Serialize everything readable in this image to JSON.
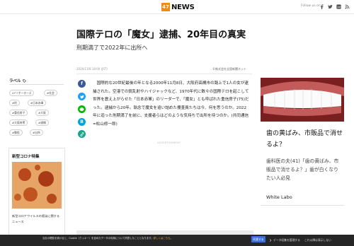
{
  "header": {
    "logo_badge": "47",
    "logo_text": "NEWS",
    "follow_label": "Follow us on",
    "social_icons": [
      "facebook-icon",
      "twitter-icon",
      "line-icon",
      "rss-icon"
    ]
  },
  "article": {
    "title": "国際テロの「魔女」逮捕、20年目の真実",
    "subtitle": "刑期満了で2022年に出所へ",
    "date": "2020/11/8 18:00 (JST)",
    "source": "©株式会社全国新聞ネット",
    "paragraph": "　国際的な20世紀最後の年となる2000年11月8日、大阪府高槻市の路上で1人の女が逮捕された。空港での銃乱射やハイジャックなど、1970年代に数々の国際テロを起こして世界を震え上がらせた「日本赤軍」のリーダーで、「魔女」とも呼ばれた重信房子(75)だった。逮捕から20年。執念で魔女を追い詰めた捜査員たちは今、何を思うのか。2022年に迫った刑期満了を前に、支援者らはどのような気持ちで出所を待つのか。(共同通信=松山修一郎)",
    "ad_label": "ADVERTISEMENT",
    "share_icons": [
      "facebook-icon",
      "twitter-icon",
      "line-icon",
      "hatena-icon",
      "copy-link-icon"
    ]
  },
  "sidebar": {
    "label_heading": "ラベル",
    "tags": [
      "47リポーターズ",
      "#社会",
      "#刑",
      "#日本赤軍",
      "#重信房子",
      "#大阪",
      "#大阪府警",
      "#逮捕",
      "#懲役",
      "#出所"
    ],
    "corona_title": "新型コロナ特集",
    "corona_text": "新型コロナウイルスの感染に関するニュース"
  },
  "right_ad": {
    "headline": "歯の黄ばみ、市販品で消せるよ？",
    "description": "歯科医の夫(41)「歯の黄ばみ、市販品で消せるよ？」歯が白くなりたい人必見",
    "brand": "White Labo"
  },
  "consent": {
    "text_before": "当社の閲覧を続けると、Cookie（クッキー）を含めたデータの利用について同意したこととなります。",
    "link_text": "詳しくはこちら",
    "text_after": "。",
    "accept_label": "同意する",
    "settings_label": "データ収集を管理する",
    "reject_label": "これ以降は表示しない"
  },
  "colors": {
    "logo_orange": "#f08a12",
    "facebook": "#3b5998",
    "twitter": "#1da1f2",
    "line": "#00b900",
    "hatena": "#00a4de",
    "consent_bg": "#262626",
    "accept_button": "#3a6fe0"
  }
}
